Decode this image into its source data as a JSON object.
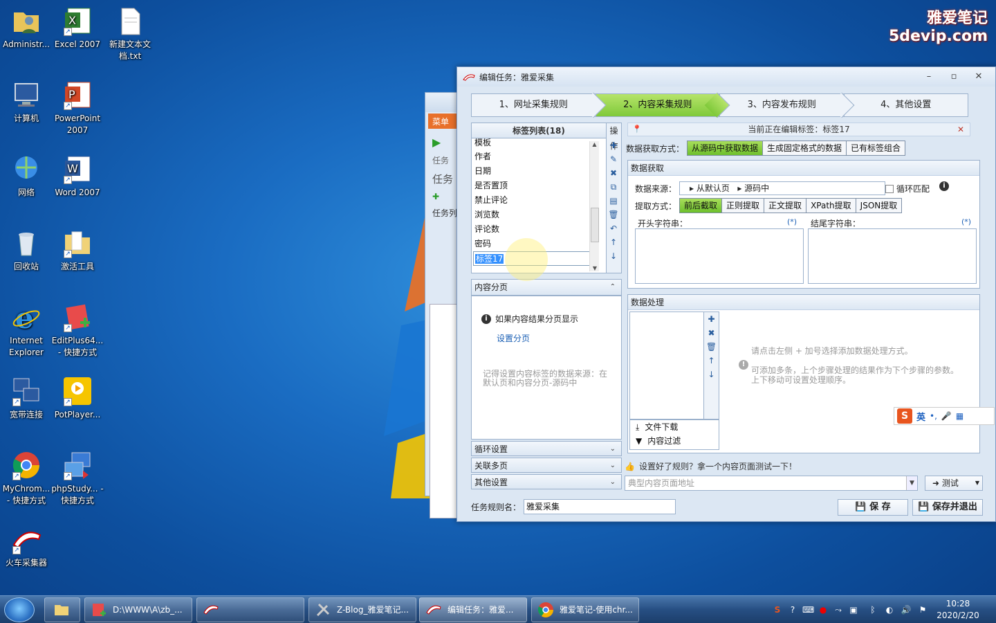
{
  "brand": {
    "line1": "雅爱笔记",
    "line2": "5devip.com"
  },
  "desktop_icons": [
    {
      "label": "Administr...",
      "icon": "user-folder-icon"
    },
    {
      "label": "Excel 2007",
      "icon": "excel-icon"
    },
    {
      "label": "新建文本文档.txt",
      "icon": "text-file-icon"
    },
    {
      "label": "计算机",
      "icon": "computer-icon"
    },
    {
      "label": "PowerPoint 2007",
      "icon": "powerpoint-icon"
    },
    {
      "label": "网络",
      "icon": "network-icon"
    },
    {
      "label": "Word 2007",
      "icon": "word-icon"
    },
    {
      "label": "回收站",
      "icon": "recycle-bin-icon"
    },
    {
      "label": "激活工具",
      "icon": "folder-icon"
    },
    {
      "label": "Internet Explorer",
      "icon": "ie-icon"
    },
    {
      "label": "EditPlus64... - 快捷方式",
      "icon": "editplus-icon"
    },
    {
      "label": "宽带连接",
      "icon": "broadband-icon"
    },
    {
      "label": "PotPlayer...",
      "icon": "potplayer-icon"
    },
    {
      "label": "MyChrom... - 快捷方式",
      "icon": "chrome-icon"
    },
    {
      "label": "phpStudy... - 快捷方式",
      "icon": "phpstudy-icon"
    },
    {
      "label": "火车采集器",
      "icon": "locoy-icon"
    }
  ],
  "bg_window": {
    "menu": "菜单",
    "task_label": "任务",
    "task_list_label": "任务",
    "task_list": "任务列"
  },
  "dialog": {
    "title": "编辑任务：雅爱采集",
    "steps": [
      "1、网址采集规则",
      "2、内容采集规则",
      "3、内容发布规则",
      "4、其他设置"
    ],
    "tag_list_header": "标签列表(18)",
    "ops_header": "操作",
    "tags": [
      "模板",
      "作者",
      "日期",
      "是否置顶",
      "禁止评论",
      "浏览数",
      "评论数",
      "密码"
    ],
    "editing_tag": "标签17",
    "paging": {
      "header": "内容分页",
      "info": "如果内容结果分页显示",
      "link": "设置分页",
      "note": "记得设置内容标签的数据来源：在默认页和内容分页-源码中"
    },
    "collapsed_sections": [
      "循环设置",
      "关联多页",
      "其他设置"
    ],
    "current_edit": "当前正在编辑标签：标签17",
    "method_label": "数据获取方式：",
    "methods": [
      "从源码中获取数据",
      "生成固定格式的数据",
      "已有标签组合"
    ],
    "data_get": {
      "header": "数据获取",
      "source_label": "数据来源：",
      "source_path": [
        "从默认页",
        "源码中"
      ],
      "loop_match": "循环匹配",
      "extract_label": "提取方式：",
      "extract_methods": [
        "前后截取",
        "正则提取",
        "正文提取",
        "XPath提取",
        "JSON提取"
      ],
      "start_label": "开头字符串：",
      "end_label": "结尾字符串：",
      "star": "(*)"
    },
    "data_proc": {
      "header": "数据处理",
      "menu": [
        "文件下载",
        "内容过滤"
      ],
      "hint1": "请点击左侧 + 加号选择添加数据处理方式。",
      "hint2": "可添加多条，上个步骤处理的结果作为下个步骤的参数。上下移动可设置处理顺序。"
    },
    "test_tip": "设置好了规则？拿一个内容页面测试一下！",
    "url_placeholder": "典型内容页面地址",
    "test_button": "测试",
    "rule_name_label": "任务规则名：",
    "rule_name_value": "雅爱采集",
    "save_button": "保 存",
    "save_exit_button": "保存并退出"
  },
  "ime": {
    "mode": "英"
  },
  "taskbar": {
    "items": [
      "D:\\WWW\\A\\zb_...",
      "",
      "Z-Blog_雅爱笔记...",
      "编辑任务：雅爱...",
      "雅爱笔记-使用chr..."
    ],
    "time": "10:28",
    "date": "2020/2/20"
  }
}
